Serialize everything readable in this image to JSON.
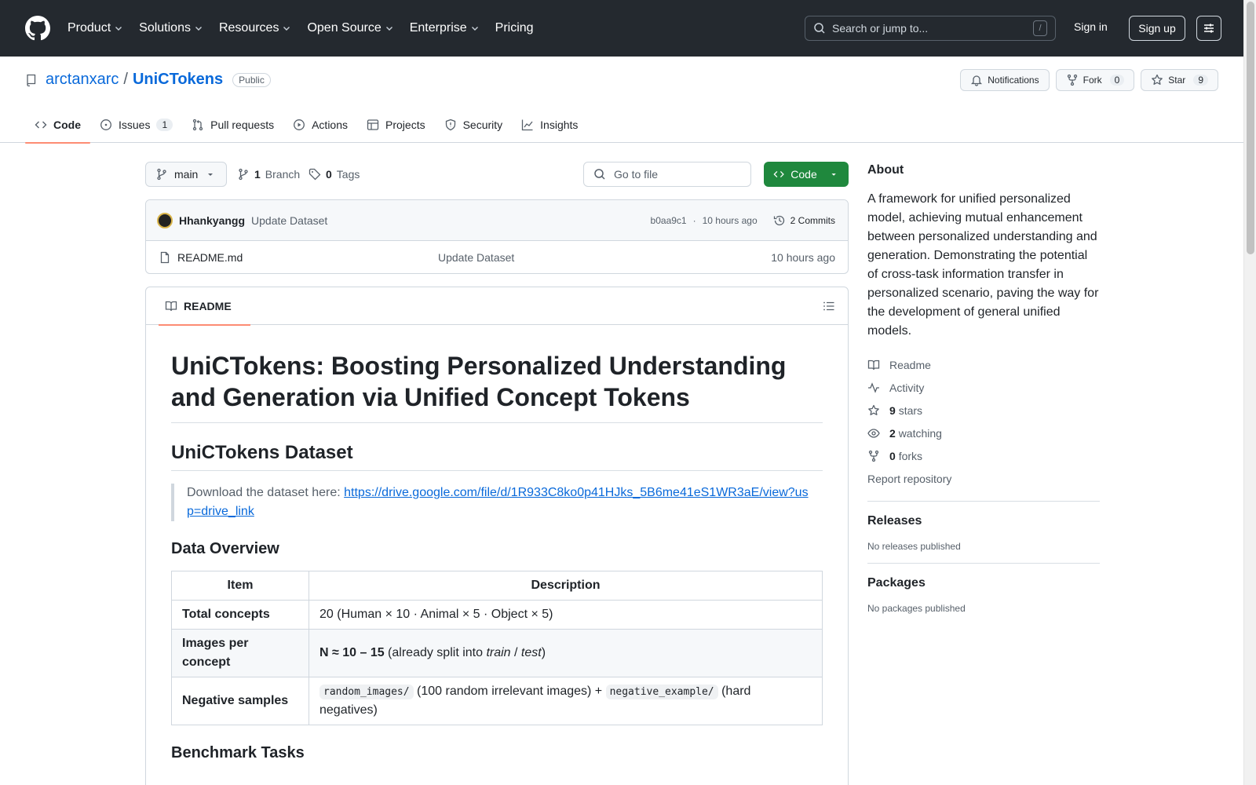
{
  "header": {
    "nav": [
      "Product",
      "Solutions",
      "Resources",
      "Open Source",
      "Enterprise",
      "Pricing"
    ],
    "search_placeholder": "Search or jump to...",
    "search_key": "/",
    "sign_in": "Sign in",
    "sign_up": "Sign up"
  },
  "repo": {
    "owner": "arctanxarc",
    "separator": "/",
    "name": "UniCTokens",
    "visibility": "Public",
    "notifications_label": "Notifications",
    "fork_label": "Fork",
    "fork_count": "0",
    "star_label": "Star",
    "star_count": "9"
  },
  "tabs": {
    "code": "Code",
    "issues": "Issues",
    "issues_count": "1",
    "pulls": "Pull requests",
    "actions": "Actions",
    "projects": "Projects",
    "security": "Security",
    "insights": "Insights"
  },
  "toolbar": {
    "branch": "main",
    "branch_count": "1",
    "branch_label": "Branch",
    "tag_count": "0",
    "tag_label": "Tags",
    "goto_file": "Go to file",
    "code_button": "Code"
  },
  "commit": {
    "author": "Hhankyangg",
    "message": "Update Dataset",
    "sha": "b0aa9c1",
    "dot": "·",
    "time": "10 hours ago",
    "commits": "2 Commits"
  },
  "files": [
    {
      "name": "README.md",
      "commit": "Update Dataset",
      "time": "10 hours ago"
    }
  ],
  "readme": {
    "tab_label": "README",
    "h1": "UniCTokens: Boosting Personalized Understanding and Generation via Unified Concept Tokens",
    "h2_dataset": "UniCTokens Dataset",
    "download_text": "Download the dataset here: ",
    "download_link": "https://drive.google.com/file/d/1R933C8ko0p41HJks_5B6me41eS1WR3aE/view?usp=drive_link",
    "h3_overview": "Data Overview",
    "table_headers": [
      "Item",
      "Description"
    ],
    "row1_item": "Total concepts",
    "row1_desc": "20 (Human × 10 · Animal × 5 · Object × 5)",
    "row2_item": "Images per concept",
    "row2_bold": "N ≈ 10 – 15",
    "row2_text1": " (already split into ",
    "row2_train": "train",
    "row2_slash": " / ",
    "row2_test": "test",
    "row2_text2": ")",
    "row3_item": "Negative samples",
    "row3_code1": "random_images/",
    "row3_text1": " (100 random irrelevant images) + ",
    "row3_code2": "negative_example/",
    "row3_text2": " (hard negatives)",
    "h3_benchmark": "Benchmark Tasks"
  },
  "sidebar": {
    "about": "About",
    "description": "A framework for unified personalized model, achieving mutual enhancement between personalized understanding and generation. Demonstrating the potential of cross-task information transfer in personalized scenario, paving the way for the development of general unified models.",
    "readme": "Readme",
    "activity": "Activity",
    "stars_count": "9",
    "stars_label": "stars",
    "watching_count": "2",
    "watching_label": "watching",
    "forks_count": "0",
    "forks_label": "forks",
    "report": "Report repository",
    "releases": "Releases",
    "no_releases": "No releases published",
    "packages": "Packages",
    "no_packages": "No packages published"
  },
  "colors": {
    "header_bg": "#24292f",
    "link": "#0969da",
    "code_button": "#1f883d",
    "active_tab": "#fd8c73"
  }
}
